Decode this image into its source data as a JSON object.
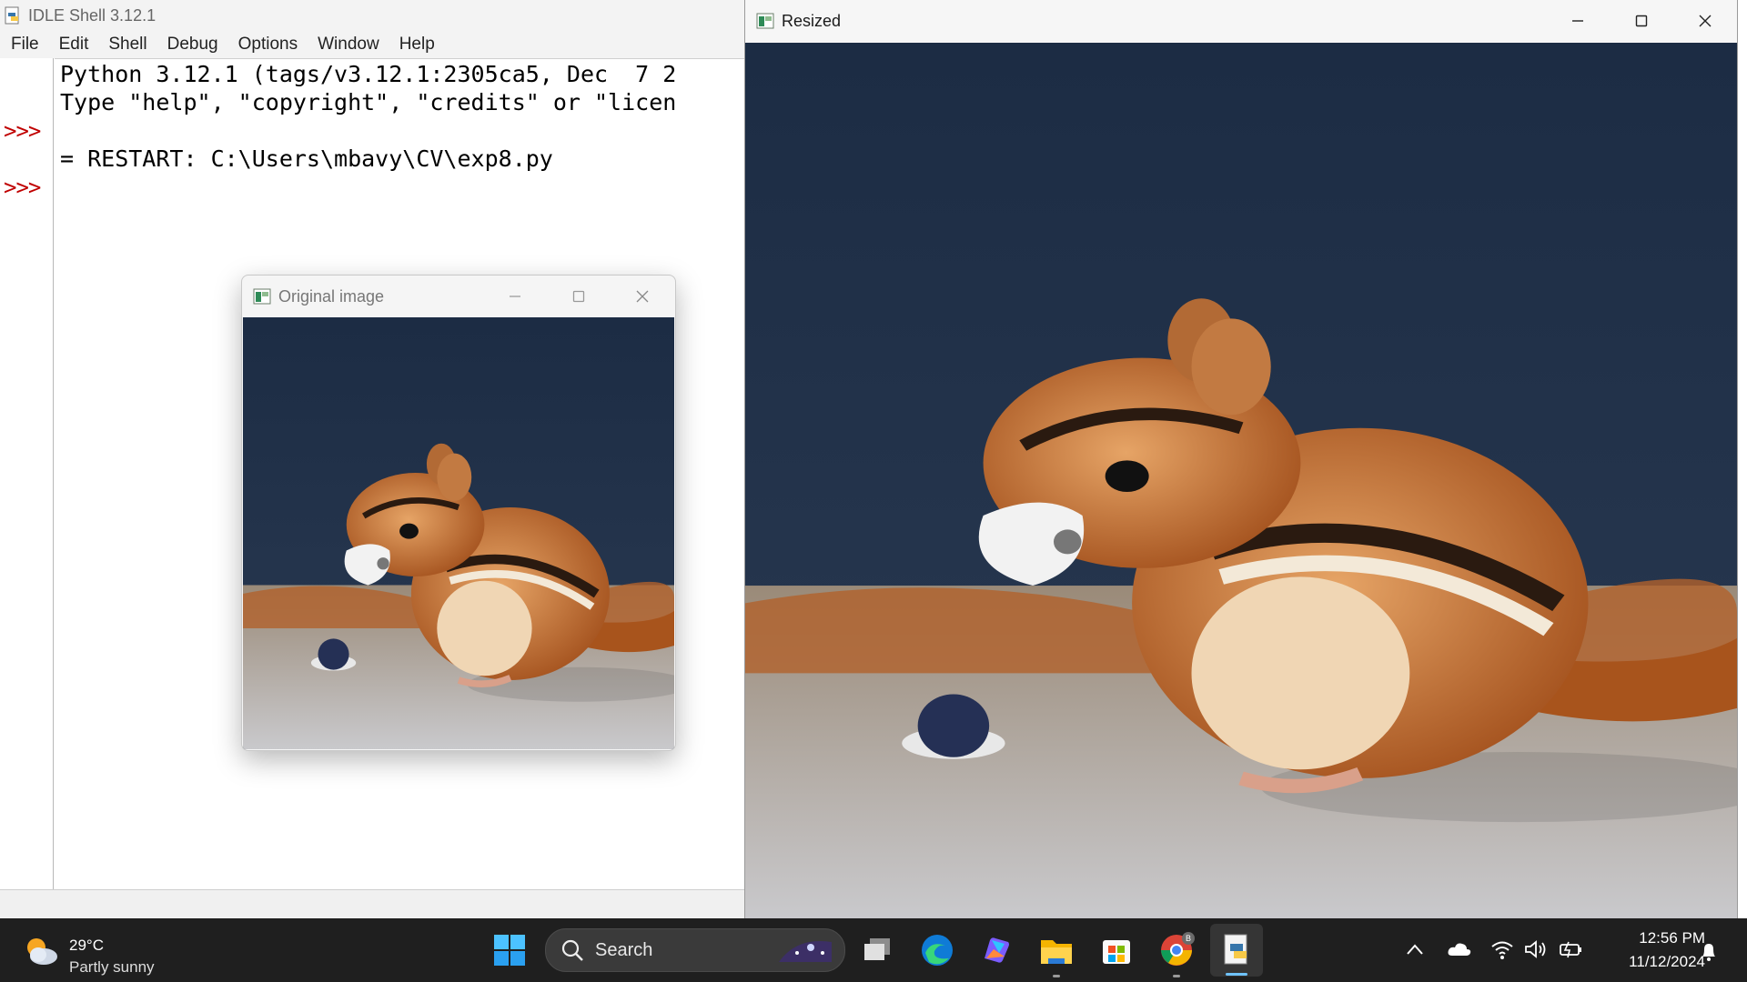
{
  "idle": {
    "title": "IDLE Shell 3.12.1",
    "menu": [
      "File",
      "Edit",
      "Shell",
      "Debug",
      "Options",
      "Window",
      "Help"
    ],
    "prompt": ">>>",
    "lines": [
      "Python 3.12.1 (tags/v3.12.1:2305ca5, Dec  7 2",
      "Type \"help\", \"copyright\", \"credits\" or \"licen",
      "= RESTART: C:\\Users\\mbavy\\CV\\exp8.py"
    ]
  },
  "original_window": {
    "title": "Original image",
    "image_desc": "chipmunk-photo"
  },
  "resized_window": {
    "title": "Resized",
    "image_desc": "chipmunk-photo-enlarged"
  },
  "taskbar": {
    "weather": {
      "temp": "29°C",
      "desc": "Partly sunny",
      "icon": "partly-sunny-icon"
    },
    "search_label": "Search",
    "apps": [
      "start-icon",
      "task-view-icon",
      "edge-icon",
      "copilot-icon",
      "file-explorer-icon",
      "store-icon",
      "chrome-icon",
      "python-idle-icon"
    ],
    "clock": {
      "time": "12:56 PM",
      "date": "11/12/2024"
    }
  },
  "colors": {
    "taskbar_bg": "#1f1f1f",
    "prompt": "#c00000",
    "photo_background": "#22334d"
  }
}
